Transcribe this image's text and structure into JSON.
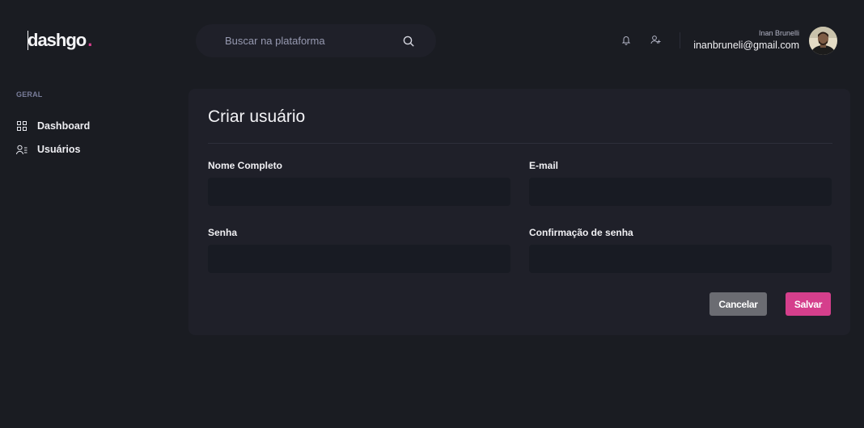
{
  "header": {
    "logo_text": "dashgo",
    "logo_dot": ".",
    "search": {
      "placeholder": "Buscar na plataforma",
      "value": ""
    },
    "icons": [
      "bell-icon",
      "user-add-icon",
      "search-icon"
    ],
    "profile": {
      "name": "Inan Brunelli",
      "email": "inanbruneli@gmail.com"
    }
  },
  "sidebar": {
    "section_title": "GERAL",
    "items": [
      {
        "label": "Dashboard",
        "icon": "dashboard-grid-icon"
      },
      {
        "label": "Usuários",
        "icon": "users-list-icon"
      }
    ]
  },
  "form": {
    "title": "Criar usuário",
    "fields": [
      {
        "label": "Nome Completo",
        "value": ""
      },
      {
        "label": "E-mail",
        "value": ""
      },
      {
        "label": "Senha",
        "value": ""
      },
      {
        "label": "Confirmação de senha",
        "value": ""
      }
    ],
    "cancel_label": "Cancelar",
    "save_label": "Salvar"
  },
  "colors": {
    "background": "#1a1c22",
    "surface": "#1f2029",
    "input": "#181b23",
    "accent": "#d53f8c",
    "cancel": "#6b6c72"
  }
}
